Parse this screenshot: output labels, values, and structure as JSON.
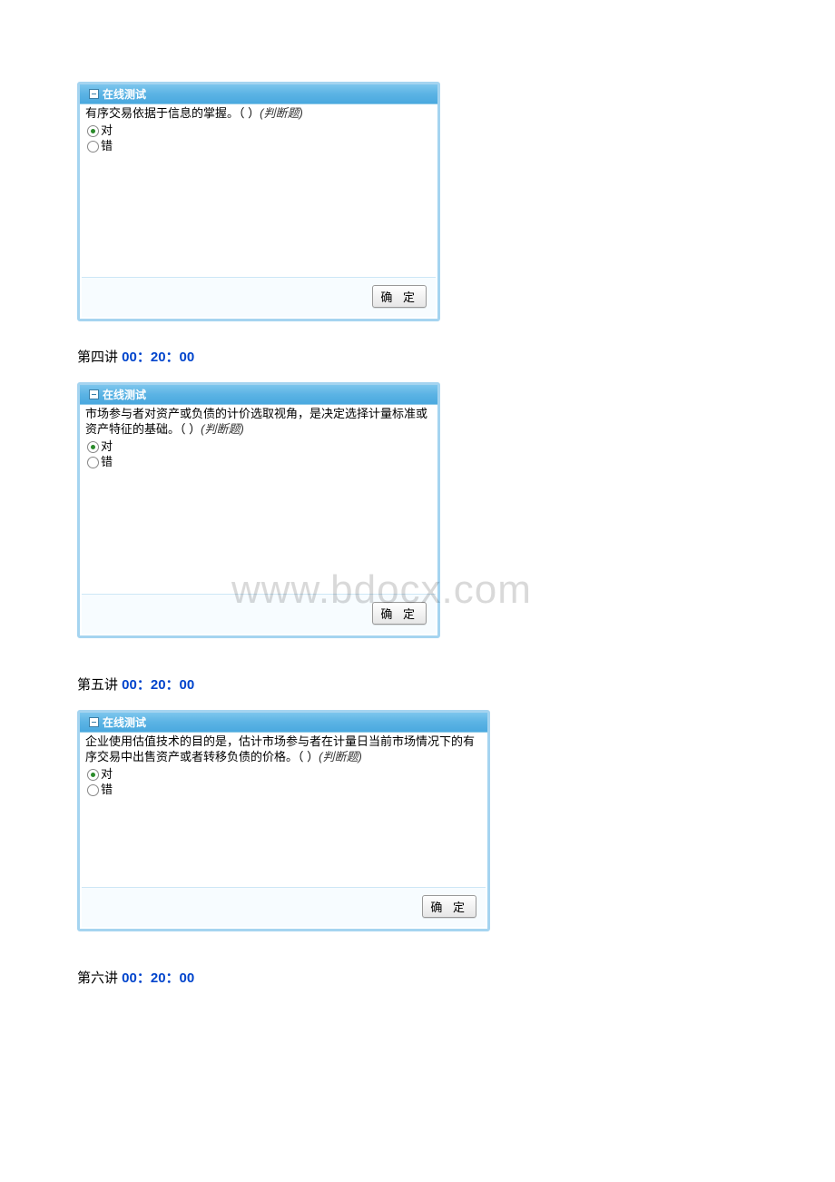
{
  "panel_title": "在线测试",
  "confirm_label": "确 定",
  "option_true": "对",
  "option_false": "错",
  "judge_tag": "(判断题)",
  "watermark": "www.bdocx.com",
  "quiz1": {
    "question": "有序交易依据于信息的掌握。（  ）"
  },
  "heading2": {
    "prefix": "第四讲 ",
    "time": "00：20：00"
  },
  "quiz2": {
    "question": "市场参与者对资产或负债的计价选取视角，是决定选择计量标准或资产特征的基础。（  ）"
  },
  "heading3": {
    "prefix": "第五讲 ",
    "time": "00：20：00"
  },
  "quiz3": {
    "question": "企业使用估值技术的目的是，估计市场参与者在计量日当前市场情况下的有序交易中出售资产或者转移负债的价格。（  ）"
  },
  "heading4": {
    "prefix": "第六讲 ",
    "time": "00：20：00"
  }
}
